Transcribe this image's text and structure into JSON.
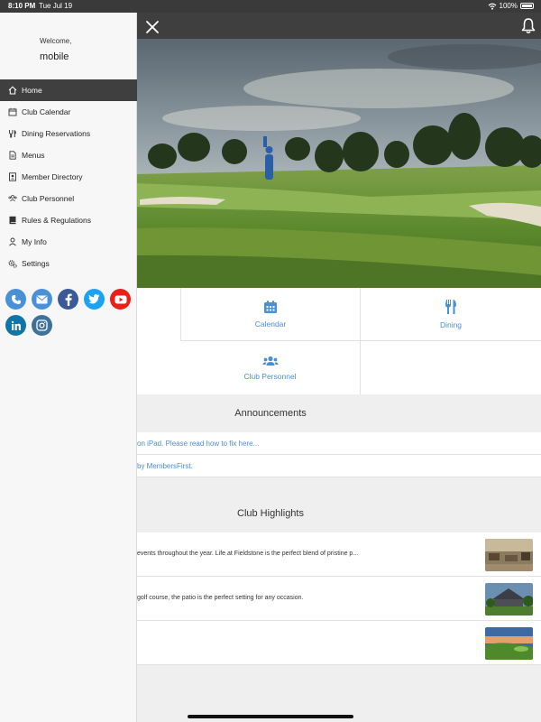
{
  "status_bar": {
    "time": "8:10 PM",
    "date": "Tue Jul 19",
    "battery": "100%"
  },
  "drawer": {
    "welcome": "Welcome,",
    "username": "mobile",
    "menu": [
      {
        "label": "Home",
        "icon": "home-icon"
      },
      {
        "label": "Club Calendar",
        "icon": "calendar-icon"
      },
      {
        "label": "Dining Reservations",
        "icon": "utensils-icon"
      },
      {
        "label": "Menus",
        "icon": "document-icon"
      },
      {
        "label": "Member Directory",
        "icon": "address-book-icon"
      },
      {
        "label": "Club Personnel",
        "icon": "users-icon"
      },
      {
        "label": "Rules & Regulations",
        "icon": "book-icon"
      },
      {
        "label": "My Info",
        "icon": "user-icon"
      },
      {
        "label": "Settings",
        "icon": "gears-icon"
      }
    ],
    "active_index": 0,
    "social": [
      "phone-icon",
      "email-icon",
      "facebook-icon",
      "twitter-icon",
      "youtube-icon",
      "linkedin-icon",
      "instagram-icon"
    ]
  },
  "tiles": {
    "calendar": "Calendar",
    "dining": "Dining",
    "personnel": "Club Personnel"
  },
  "announcements": {
    "title": "Announcements",
    "items": [
      "on iPad. Please read how to fix here...",
      "by MembersFirst."
    ]
  },
  "highlights": {
    "title": "Club Highlights",
    "items": [
      "events throughout the year. Life at Fieldstone is the perfect blend of pristine p...",
      "golf course, the patio is the perfect setting for any occasion.",
      ""
    ]
  },
  "colors": {
    "accent": "#4a90d9",
    "topbar": "#3f3f3f",
    "drawer_bg": "#f7f7f7"
  }
}
